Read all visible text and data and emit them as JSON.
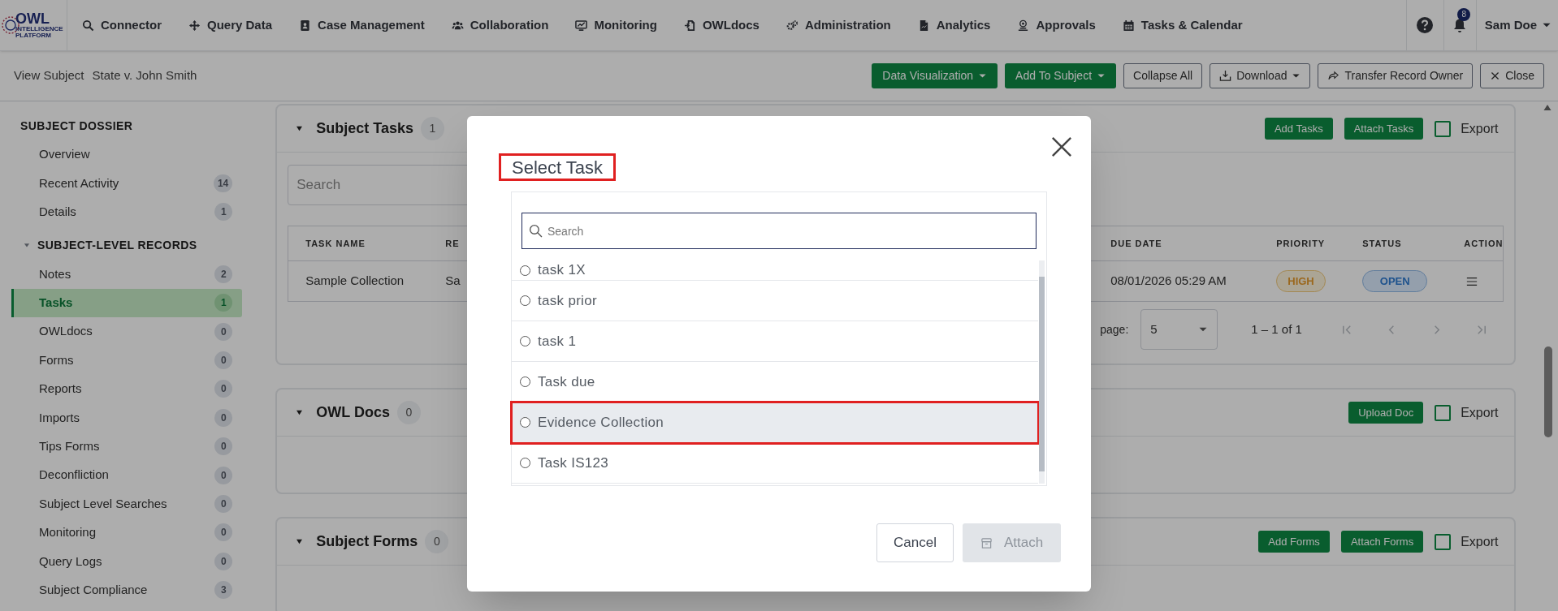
{
  "logo": {
    "text": "OWL",
    "subtext": "INTELLIGENCE PLATFORM"
  },
  "nav": [
    {
      "label": "Connector",
      "kind": "search"
    },
    {
      "label": "Query Data",
      "kind": "move"
    },
    {
      "label": "Case Management",
      "kind": "book"
    },
    {
      "label": "Collaboration",
      "kind": "users"
    },
    {
      "label": "Monitoring",
      "kind": "screen"
    },
    {
      "label": "OWLdocs",
      "kind": "docin"
    },
    {
      "label": "Administration",
      "kind": "gears"
    },
    {
      "label": "Analytics",
      "kind": "file"
    },
    {
      "label": "Approvals",
      "kind": "stamp"
    },
    {
      "label": "Tasks & Calendar",
      "kind": "calendar"
    }
  ],
  "header_right": {
    "notifications": "8",
    "user": "Sam Doe"
  },
  "breadcrumb": {
    "label": "View Subject",
    "subject": "State v. John Smith"
  },
  "actions": [
    {
      "label": "Data Visualization",
      "kind": "menu"
    },
    {
      "label": "Add To Subject",
      "kind": "menu"
    },
    {
      "label": "Collapse All",
      "kind": "plain"
    },
    {
      "label": "Download",
      "kind": "download"
    },
    {
      "label": "Transfer Record Owner",
      "kind": "forward"
    },
    {
      "label": "Close",
      "kind": "close"
    }
  ],
  "sidebar": [
    {
      "title": "SUBJECT DOSSIER",
      "collapsible": false,
      "items": [
        {
          "label": "Overview",
          "selected": false
        },
        {
          "label": "Recent Activity",
          "count": "14",
          "selected": false
        },
        {
          "label": "Details",
          "count": "1",
          "selected": false
        }
      ]
    },
    {
      "title": "SUBJECT-LEVEL RECORDS",
      "collapsible": true,
      "expanded": true,
      "items": [
        {
          "label": "Notes",
          "count": "2",
          "selected": false
        },
        {
          "label": "Tasks",
          "count": "1",
          "selected": true
        },
        {
          "label": "OWLdocs",
          "count": "0",
          "selected": false
        },
        {
          "label": "Forms",
          "count": "0",
          "selected": false
        },
        {
          "label": "Reports",
          "count": "0",
          "selected": false
        },
        {
          "label": "Imports",
          "count": "0",
          "selected": false
        },
        {
          "label": "Tips Forms",
          "count": "0",
          "selected": false
        },
        {
          "label": "Deconfliction",
          "count": "0",
          "selected": false
        },
        {
          "label": "Subject Level Searches",
          "count": "0",
          "selected": false
        },
        {
          "label": "Monitoring",
          "count": "0",
          "selected": false
        },
        {
          "label": "Query Logs",
          "count": "0",
          "selected": false
        },
        {
          "label": "Subject Compliance",
          "count": "3",
          "selected": false
        }
      ]
    }
  ],
  "panels": [
    {
      "title": "Subject Tasks",
      "count": "1",
      "expanded": true,
      "buttons": [
        "Add Tasks",
        "Attach Tasks"
      ],
      "export": {
        "label": "Export",
        "checked": false
      },
      "search": {
        "placeholder": "Search"
      },
      "table": {
        "columns": [
          "TASK NAME",
          "RE",
          "DUE DATE",
          "PRIORITY",
          "STATUS",
          "ACTION"
        ],
        "rows": [
          {
            "cells": [
              {
                "kind": "text",
                "text": "Sample Collection"
              },
              {
                "kind": "text",
                "text": "Sa"
              },
              {
                "kind": "text",
                "text": "08/01/2026 05:29 AM"
              },
              {
                "kind": "priority",
                "text": "HIGH"
              },
              {
                "kind": "status",
                "text": "OPEN"
              },
              {
                "kind": "menu"
              }
            ]
          }
        ]
      },
      "pagination": {
        "label": "page:",
        "page_size": "5",
        "range": "1 – 1 of 1"
      }
    },
    {
      "title": "OWL Docs",
      "count": "0",
      "expanded": true,
      "buttons": [
        "Upload Doc"
      ],
      "export": {
        "label": "Export",
        "checked": false
      }
    },
    {
      "title": "Subject Forms",
      "count": "0",
      "expanded": true,
      "buttons": [
        "Add Forms",
        "Attach Forms"
      ],
      "export": {
        "label": "Export",
        "checked": false
      }
    }
  ],
  "modal": {
    "title": "Select Task",
    "title_outlined": true,
    "search": {
      "placeholder": "Search"
    },
    "items": [
      {
        "label": "task 1X",
        "selected": false,
        "hovered": false,
        "outlined": false
      },
      {
        "label": "task prior",
        "selected": false,
        "hovered": false,
        "outlined": false
      },
      {
        "label": "task 1",
        "selected": false,
        "hovered": false,
        "outlined": false
      },
      {
        "label": "Task due",
        "selected": false,
        "hovered": false,
        "outlined": false
      },
      {
        "label": "Evidence Collection",
        "selected": false,
        "hovered": true,
        "outlined": true
      },
      {
        "label": "Task IS123",
        "selected": false,
        "hovered": false,
        "outlined": false
      }
    ],
    "cancel": "Cancel",
    "attach": {
      "label": "Attach",
      "disabled": true
    }
  }
}
